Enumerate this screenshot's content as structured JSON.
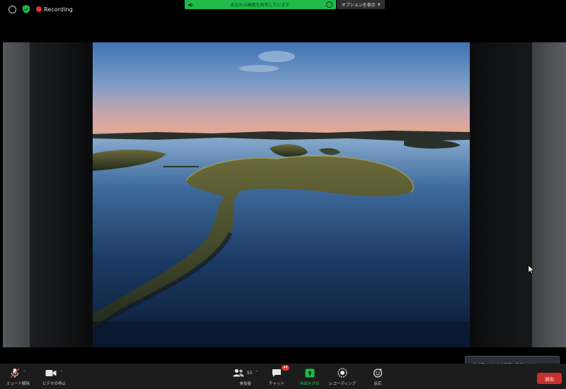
{
  "top_bar": {
    "recording_label": "Recording",
    "share_banner_text": "あなたは画面を共有しています",
    "options_label": "オプションを表示",
    "colors": {
      "banner": "#20b94a",
      "recording": "#e0322e"
    }
  },
  "shared_content": {
    "description_icon": "landscape-photo"
  },
  "notification": {
    "text": "参加者はあなたの画面を見ています"
  },
  "toolbar": {
    "mute_label": "ミュート解除",
    "video_label": "ビデオの停止",
    "participants_label": "参加者",
    "participants_count": "55",
    "chat_label": "チャット",
    "chat_badge": "44",
    "share_label": "画面を共有",
    "record_label": "レコーディング",
    "reactions_label": "反応",
    "end_label": "退出"
  }
}
